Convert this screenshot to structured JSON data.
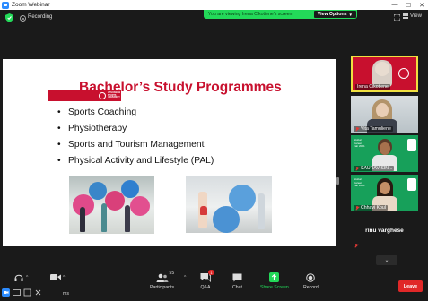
{
  "window": {
    "title": "Zoom Webinar",
    "controls": [
      "—",
      "☐",
      "✕"
    ]
  },
  "topbar": {
    "recording_label": "Recording",
    "viewing_banner": "You are viewing Irena Cikotiene's screen",
    "view_options_label": "View Options",
    "view_label": "View"
  },
  "slide": {
    "logo_text": "LITHUANIAN SPORTS UNIVERSITY",
    "title": "Bachelor’s Study Programmes",
    "items": [
      "Sports Coaching",
      "Physiotherapy",
      "Sports and Tourism Management",
      "Physical Activity and Lifestyle (PAL)"
    ]
  },
  "gallery": {
    "participants": [
      {
        "name": "Irena Cikotiene",
        "muted": false,
        "active": true
      },
      {
        "name": "Vita Tamuliene",
        "muted": true,
        "active": false
      },
      {
        "name": "SAURAV SIN...",
        "muted": true,
        "active": false
      },
      {
        "name": "Chhavi Koul",
        "muted": true,
        "active": false
      },
      {
        "name": "rinu varghese",
        "muted": true,
        "active": false
      }
    ],
    "scroll_down_icon": "chevron-down-icon"
  },
  "toolbar": {
    "participants_label": "Participants",
    "participants_count": "55",
    "qa_label": "Q&A",
    "qa_badge": "1",
    "chat_label": "Chat",
    "share_label": "Share Screen",
    "record_label": "Record",
    "leave_label": "Leave",
    "audio_partial_label": "ms"
  },
  "colors": {
    "accent_green": "#23d959",
    "brand_red": "#c8102e",
    "leave_red": "#e02828",
    "active_speaker_border": "#f0e040"
  }
}
